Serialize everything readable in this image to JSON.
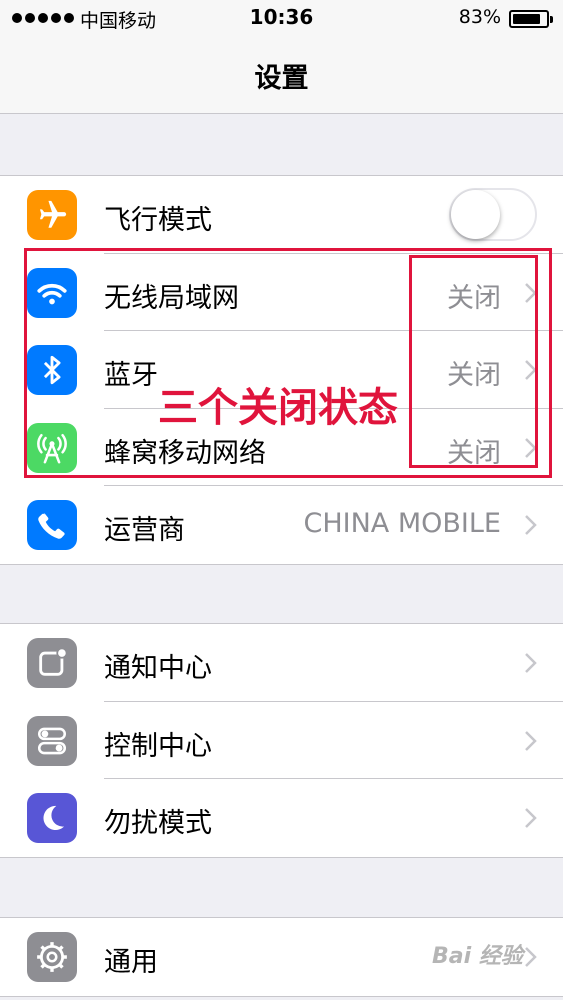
{
  "status_bar": {
    "carrier": "中国移动",
    "time": "10:36",
    "battery_percent": "83%",
    "battery_level": 0.83,
    "signal_bars": 5
  },
  "nav": {
    "title": "设置"
  },
  "group1": [
    {
      "label": "飞行模式",
      "icon": "airplane-icon",
      "icon_color": "#ff9500",
      "toggle": false
    },
    {
      "label": "无线局域网",
      "icon": "wifi-icon",
      "icon_color": "#007aff",
      "value": "关闭"
    },
    {
      "label": "蓝牙",
      "icon": "bluetooth-icon",
      "icon_color": "#007aff",
      "value": "关闭"
    },
    {
      "label": "蜂窝移动网络",
      "icon": "cellular-icon",
      "icon_color": "#4cd964",
      "value": "关闭"
    },
    {
      "label": "运营商",
      "icon": "phone-icon",
      "icon_color": "#007aff",
      "value": "CHINA MOBILE"
    }
  ],
  "group2": [
    {
      "label": "通知中心",
      "icon": "notification-center-icon",
      "icon_color": "#8e8e93"
    },
    {
      "label": "控制中心",
      "icon": "control-center-icon",
      "icon_color": "#8e8e93"
    },
    {
      "label": "勿扰模式",
      "icon": "moon-icon",
      "icon_color": "#5856d6"
    }
  ],
  "group3": [
    {
      "label": "通用",
      "icon": "gear-icon",
      "icon_color": "#8e8e93"
    }
  ],
  "annotation": {
    "text": "三个关闭状态",
    "color": "#e0143c"
  },
  "watermark": {
    "text": "Bai 经验"
  }
}
